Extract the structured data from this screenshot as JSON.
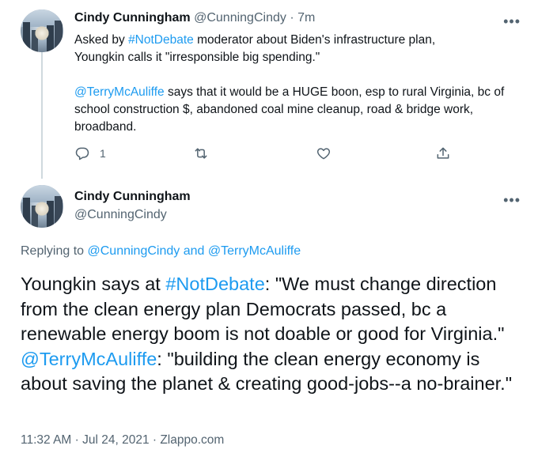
{
  "tweet1": {
    "name": "Cindy Cunningham",
    "handle": "@CunningCindy",
    "sep": "·",
    "time": "7m",
    "more": "•••",
    "line1_pre": "Asked by ",
    "line1_tag": "#NotDebate",
    "line1_post": " moderator about Biden's infrastructure plan,",
    "line2": "Youngkin calls it \"irresponsible big spending.\"",
    "mention": "@TerryMcAuliffe",
    "para2_text": " says that it would be a HUGE boon, esp to rural Virginia, bc of school construction $, abandoned coal mine cleanup, road & bridge work, broadband.",
    "actions": {
      "reply_count": "1",
      "reply_icon": "reply-icon",
      "retweet_icon": "retweet-icon",
      "like_icon": "heart-icon",
      "share_icon": "share-icon"
    }
  },
  "tweet2": {
    "name": "Cindy Cunningham",
    "handle": "@CunningCindy",
    "more": "•••",
    "replying_label": "Replying to ",
    "replying_user1": "@CunningCindy",
    "replying_and": " and ",
    "replying_user2": "@TerryMcAuliffe",
    "text_pre": "Youngkin says at ",
    "text_tag": "#NotDebate",
    "text_mid": ": \"We must change direction from the clean energy plan Democrats passed, bc a renewable energy boom is not doable or good for Virginia.\" ",
    "text_mention": "@TerryMcAuliffe",
    "text_post": ": \"building the clean energy economy is about saving the planet & creating good-jobs--a no-brainer.\"",
    "timestamp": "11:32 AM · Jul 24, 2021 · Zlappo.com"
  },
  "colors": {
    "link": "#1d9bf0",
    "muted": "#536471",
    "text": "#0f1419",
    "thread_line": "#cfd9de"
  }
}
